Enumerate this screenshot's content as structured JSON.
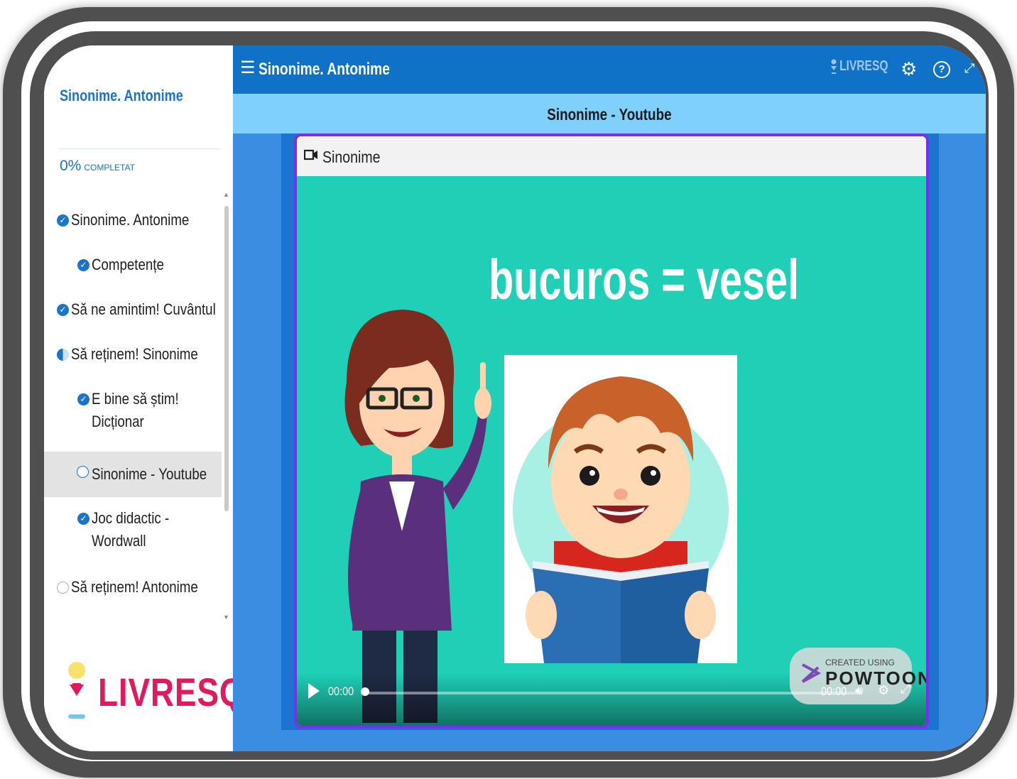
{
  "sidebar": {
    "title": "Sinonime. Antonime",
    "progress_pct": "0%",
    "progress_label": "COMPLETAT",
    "items": [
      {
        "label": "Sinonime. Antonime",
        "status": "done"
      },
      {
        "label": "Competențe",
        "status": "done"
      },
      {
        "label": "Să ne amintim! Cuvântul",
        "status": "done"
      },
      {
        "label": "Să reținem! Sinonime",
        "status": "partial"
      },
      {
        "label_line1": "E bine să știm!",
        "label_line2": "Dicționar",
        "status": "done"
      },
      {
        "label": "Sinonime - Youtube",
        "status": "current"
      },
      {
        "label_line1": "Joc didactic -",
        "label_line2": "Wordwall",
        "status": "done"
      },
      {
        "label": "Să reținem! Antonime",
        "status": "empty"
      }
    ],
    "logo_text": "LIVRESQ"
  },
  "topbar": {
    "title": "Sinonime. Antonime",
    "brand": "LIVRESQ"
  },
  "subbar": {
    "title": "Sinonime  - Youtube"
  },
  "card": {
    "title": "Sinonime"
  },
  "video": {
    "headline": "bucuros = vesel",
    "current_time": "00:00",
    "end_time": "00:00",
    "watermark_small": "CREATED USING",
    "watermark_big": "POWTOON",
    "progress": 0
  },
  "colors": {
    "accent": "#1a74c8",
    "topbar": "#0f72c7",
    "subbar": "#7fd0fd",
    "card_border": "#7d2df0",
    "video_bg": "#1fcfb6",
    "logo": "#e3195d"
  },
  "icons": [
    "menu-icon",
    "gear-icon",
    "help-icon",
    "expand-icon",
    "camera-icon",
    "play-icon",
    "volume-icon",
    "fullscreen-icon",
    "check-icon"
  ]
}
